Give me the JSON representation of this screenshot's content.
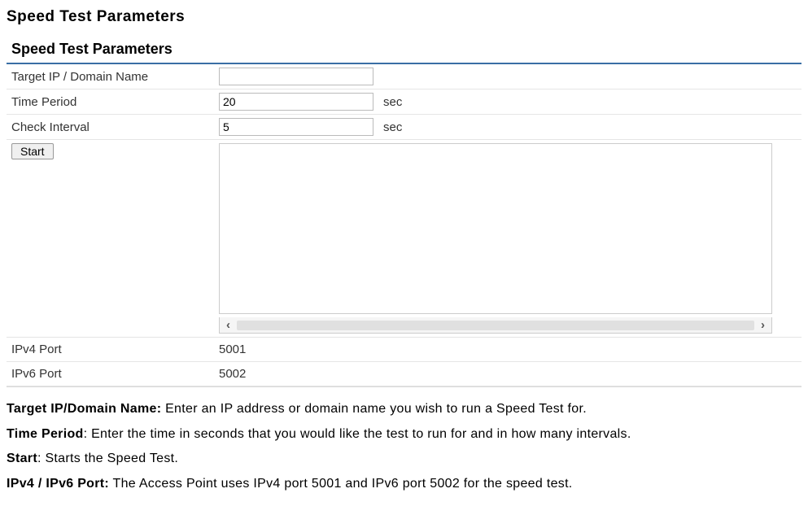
{
  "pageHeading": "Speed Test Parameters",
  "panel": {
    "title": "Speed Test Parameters",
    "rows": {
      "targetIp": {
        "label": "Target IP / Domain Name",
        "value": "",
        "unit": ""
      },
      "timePeriod": {
        "label": "Time Period",
        "value": "20",
        "unit": "sec"
      },
      "checkInterval": {
        "label": "Check Interval",
        "value": "5",
        "unit": "sec"
      },
      "startLabel": "Start",
      "ipv4Port": {
        "label": "IPv4 Port",
        "value": "5001"
      },
      "ipv6Port": {
        "label": "IPv6 Port",
        "value": "5002"
      }
    }
  },
  "descriptions": {
    "d1": {
      "bold": "Target IP/Domain Name:",
      "text": " Enter an IP address or domain name you wish to run a Speed Test for."
    },
    "d2": {
      "bold": "Time Period",
      "text": ": Enter the time in seconds that you would like the test to run for and in how many intervals."
    },
    "d3": {
      "bold": "Start",
      "text": ": Starts the Speed Test."
    },
    "d4": {
      "bold": "IPv4 / IPv6 Port:",
      "text": " The Access Point uses IPv4 port 5001 and IPv6 port 5002 for the speed test."
    }
  },
  "scroll": {
    "left": "‹",
    "right": "›"
  }
}
